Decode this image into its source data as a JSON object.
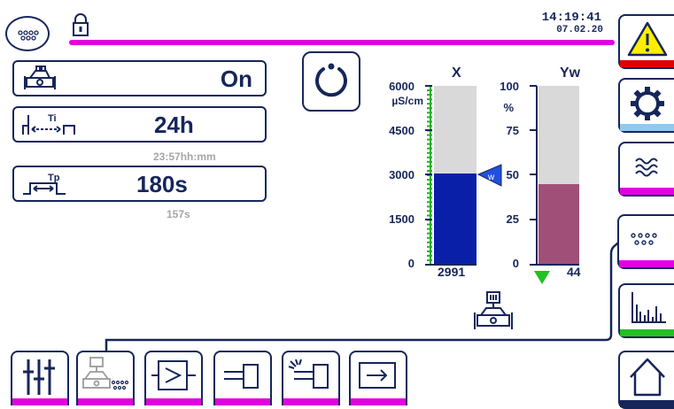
{
  "status": {
    "time": "14:19:41",
    "date": "07.02.20"
  },
  "cards": {
    "mode": {
      "value": "On"
    },
    "interval": {
      "value": "24h",
      "remaining": "23:57hh:mm"
    },
    "pause": {
      "value": "180s",
      "remaining": "157s"
    }
  },
  "gauge_x": {
    "title": "X",
    "unit": "µS/cm",
    "ticks": [
      "6000",
      "4500",
      "3000",
      "1500",
      "0"
    ],
    "value": "2991",
    "setpoint_label": "w",
    "fill_color": "#0a1fa8",
    "empty_color": "#d9d9d9",
    "scale_color": "#22b222"
  },
  "gauge_yw": {
    "title": "Yw",
    "unit": "%",
    "ticks": [
      "100",
      "75",
      "50",
      "25",
      "0"
    ],
    "value": "44",
    "fill_color": "#a05078",
    "empty_color": "#d9d9d9"
  },
  "tabs": [
    {
      "icon": "warning-icon",
      "strip": "#e00000"
    },
    {
      "icon": "gear-icon",
      "strip": "#8ec9ef"
    },
    {
      "icon": "waves-icon",
      "strip": "#e000e0"
    },
    {
      "icon": "dots-icon",
      "strip": "#e000e0"
    },
    {
      "icon": "bar-chart-icon",
      "strip": "#22c022"
    },
    {
      "icon": "home-icon",
      "strip": "#16265a"
    }
  ],
  "bottom": [
    {
      "icon": "sliders-icon"
    },
    {
      "icon": "valve-dots-icon"
    },
    {
      "icon": "controller-icon"
    },
    {
      "icon": "actuator-icon"
    },
    {
      "icon": "actuator-signal-icon"
    },
    {
      "icon": "output-arrow-icon"
    }
  ]
}
